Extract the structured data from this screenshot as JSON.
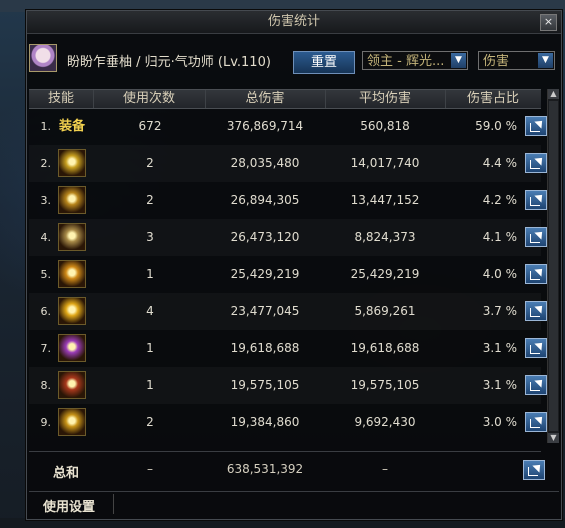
{
  "window": {
    "title": "伤害统计",
    "close_label": "×"
  },
  "character": {
    "name": "盼盼乍垂柚 / 归元·气功师 (Lv.110)"
  },
  "toolbar": {
    "reset_label": "重置",
    "boss_filter": "领主 - 辉光...",
    "metric_filter": "伤害"
  },
  "columns": [
    "技能",
    "使用次数",
    "总伤害",
    "平均伤害",
    "伤害占比"
  ],
  "rows": [
    {
      "rank": "1.",
      "skill_label": "装备",
      "icon": "equipment-label",
      "uses": "672",
      "total": "376,869,714",
      "avg": "560,818",
      "pct": "59.0 %"
    },
    {
      "rank": "2.",
      "skill_label": "",
      "icon": "yellow-burst-skill-icon",
      "color": "#c8a020",
      "uses": "2",
      "total": "28,035,480",
      "avg": "14,017,740",
      "pct": "4.4 %"
    },
    {
      "rank": "3.",
      "skill_label": "",
      "icon": "flame-figure-skill-icon",
      "color": "#b8861c",
      "uses": "2",
      "total": "26,894,305",
      "avg": "13,447,152",
      "pct": "4.2 %"
    },
    {
      "rank": "4.",
      "skill_label": "",
      "icon": "group-figures-skill-icon",
      "color": "#a88a48",
      "uses": "3",
      "total": "26,473,120",
      "avg": "8,824,373",
      "pct": "4.1 %"
    },
    {
      "rank": "5.",
      "skill_label": "",
      "icon": "spiral-orange-skill-icon",
      "color": "#d08a18",
      "uses": "1",
      "total": "25,429,219",
      "avg": "25,429,219",
      "pct": "4.0 %"
    },
    {
      "rank": "6.",
      "skill_label": "",
      "icon": "figure-stance-skill-icon",
      "color": "#e0a818",
      "uses": "4",
      "total": "23,477,045",
      "avg": "5,869,261",
      "pct": "3.7 %"
    },
    {
      "rank": "7.",
      "skill_label": "",
      "icon": "purple-energy-skill-icon",
      "color": "#9a3cb8",
      "uses": "1",
      "total": "19,618,688",
      "avg": "19,618,688",
      "pct": "3.1 %"
    },
    {
      "rank": "8.",
      "skill_label": "",
      "icon": "red-demon-skill-icon",
      "color": "#a8381c",
      "uses": "1",
      "total": "19,575,105",
      "avg": "19,575,105",
      "pct": "3.1 %"
    },
    {
      "rank": "9.",
      "skill_label": "",
      "icon": "golden-face-skill-icon",
      "color": "#c89418",
      "uses": "2",
      "total": "19,384,860",
      "avg": "9,692,430",
      "pct": "3.0 %"
    }
  ],
  "summary": {
    "label": "总和",
    "uses": "–",
    "total": "638,531,392",
    "avg": "–"
  },
  "footer": {
    "settings_label": "使用设置"
  }
}
